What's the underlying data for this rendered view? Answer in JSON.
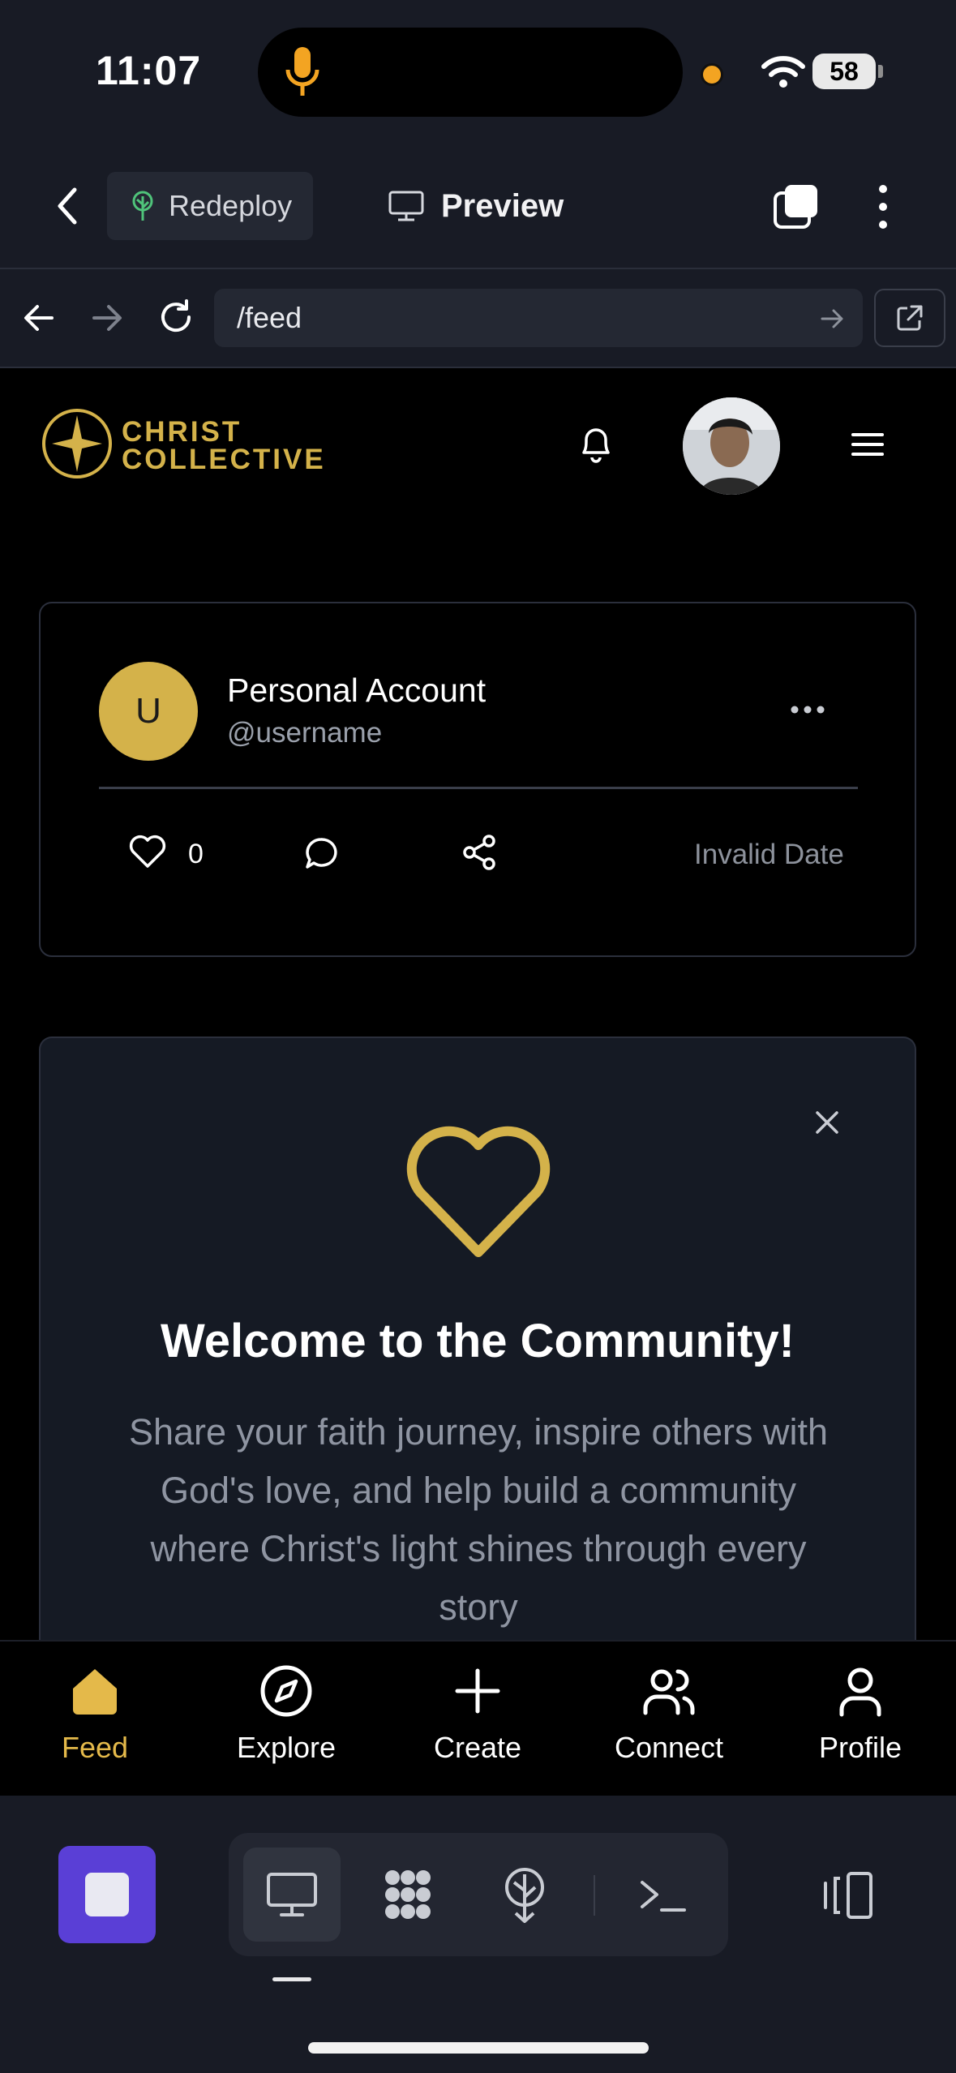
{
  "status_bar": {
    "time": "11:07",
    "battery": "58"
  },
  "toolbar": {
    "redeploy_label": "Redeploy",
    "preview_label": "Preview"
  },
  "url_bar": {
    "url": "/feed"
  },
  "brand": {
    "line1": "CHRIST",
    "line2": "COLLECTIVE",
    "color": "#d4b24a"
  },
  "post": {
    "avatar_letter": "U",
    "name": "Personal Account",
    "handle": "@username",
    "likes": "0",
    "date": "Invalid Date"
  },
  "welcome": {
    "title": "Welcome to the Community!",
    "body": "Share your faith journey, inspire others with God's love, and help build a community where Christ's light shines through every story"
  },
  "tabs": [
    {
      "label": "Feed",
      "icon": "home-icon",
      "active": true
    },
    {
      "label": "Explore",
      "icon": "compass-icon",
      "active": false
    },
    {
      "label": "Create",
      "icon": "plus-icon",
      "active": false
    },
    {
      "label": "Connect",
      "icon": "users-icon",
      "active": false
    },
    {
      "label": "Profile",
      "icon": "user-icon",
      "active": false
    }
  ],
  "colors": {
    "accent": "#e4b94a",
    "background": "#000000",
    "card": "#151a24",
    "stop_button": "#5a3fd6"
  }
}
